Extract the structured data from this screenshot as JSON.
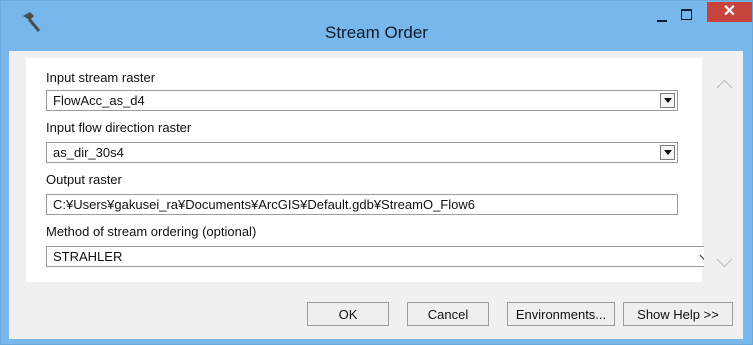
{
  "window": {
    "title": "Stream Order",
    "close_label": "✕"
  },
  "form": {
    "input_stream_label": "Input stream raster",
    "input_stream_value": "FlowAcc_as_d4",
    "input_flow_label": "Input flow direction raster",
    "input_flow_value": "as_dir_30s4",
    "output_label": "Output raster",
    "output_value": "C:¥Users¥gakusei_ra¥Documents¥ArcGIS¥Default.gdb¥StreamO_Flow6",
    "method_label": "Method of stream ordering (optional)",
    "method_value": "STRAHLER"
  },
  "buttons": {
    "ok": "OK",
    "cancel": "Cancel",
    "environments": "Environments...",
    "help": "Show Help >>"
  }
}
